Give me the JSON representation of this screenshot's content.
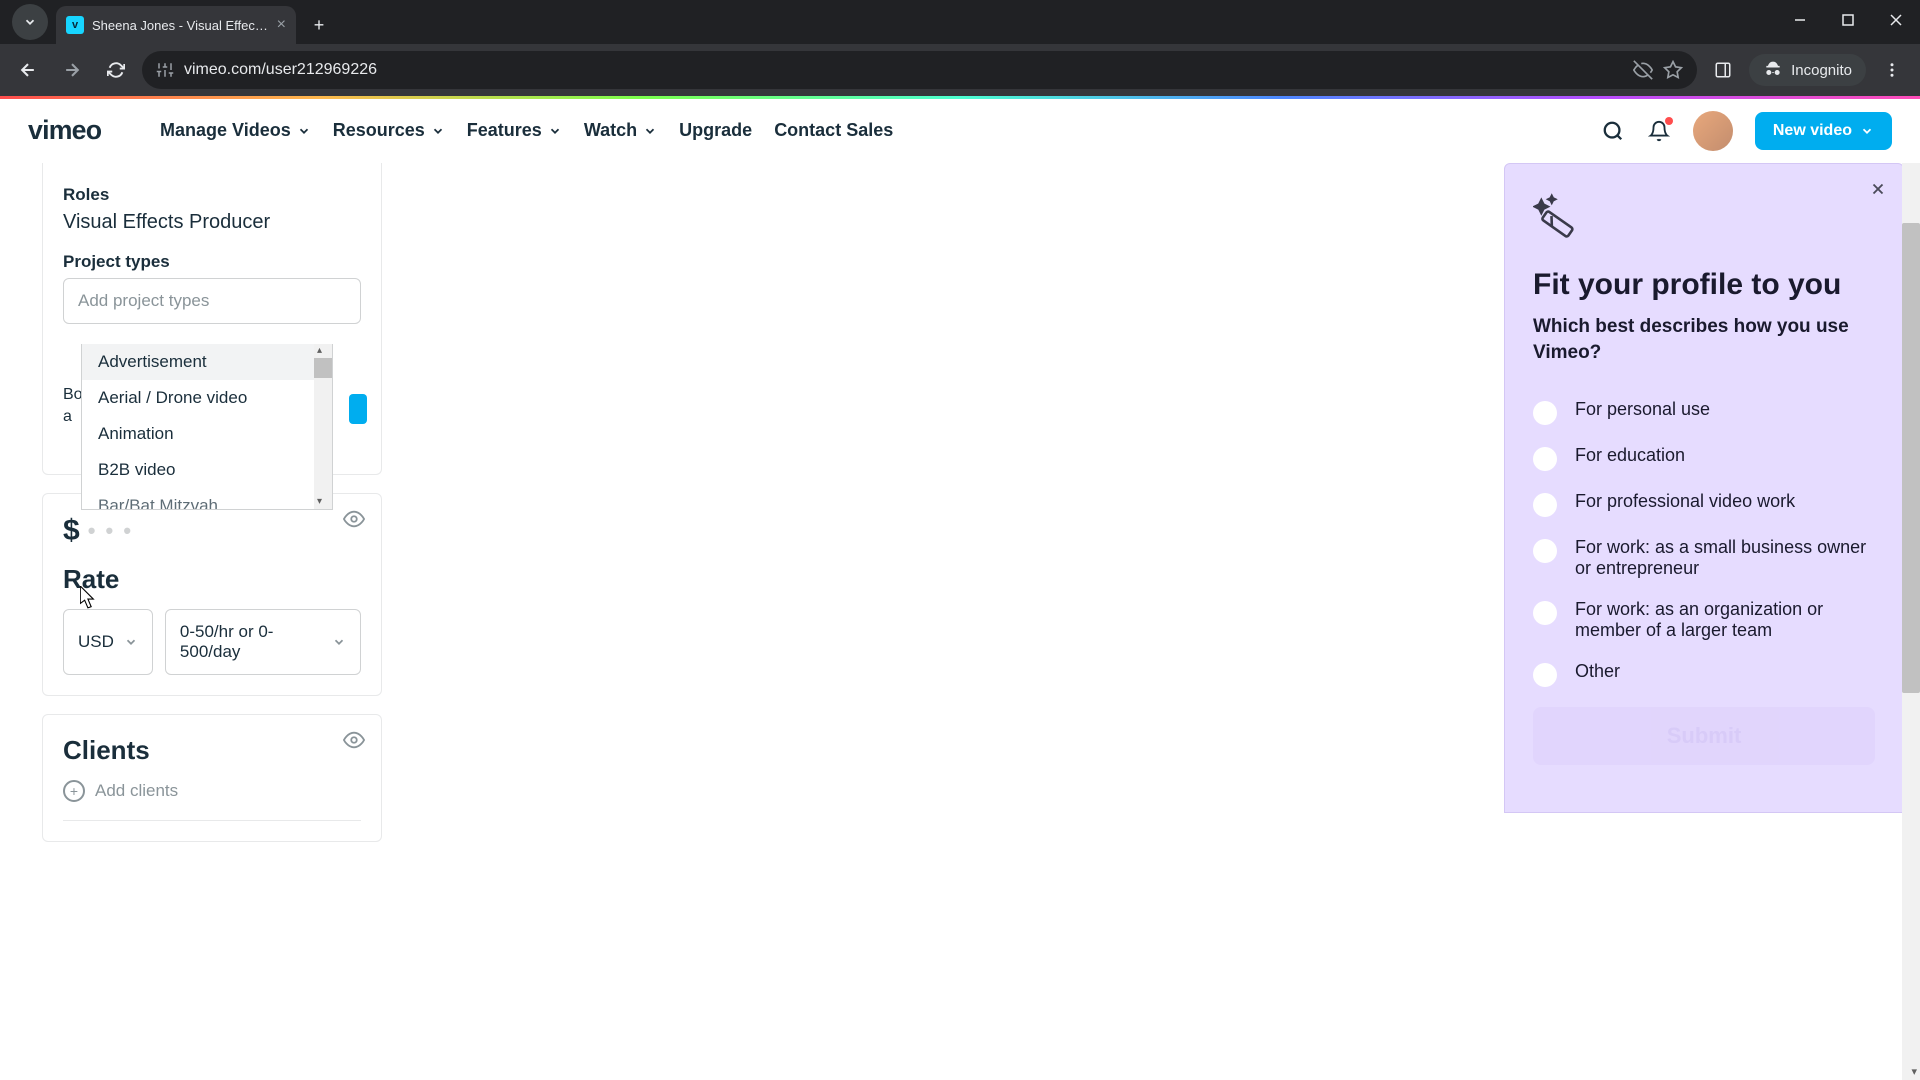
{
  "browser": {
    "tab_title": "Sheena Jones - Visual Effects P",
    "url": "vimeo.com/user212969226",
    "incognito_label": "Incognito"
  },
  "header": {
    "nav": {
      "manage": "Manage Videos",
      "resources": "Resources",
      "features": "Features",
      "watch": "Watch",
      "upgrade": "Upgrade",
      "contact": "Contact Sales"
    },
    "new_video": "New video"
  },
  "profile": {
    "roles_label": "Roles",
    "roles_value": "Visual Effects Producer",
    "project_types_label": "Project types",
    "project_types_placeholder": "Add project types",
    "dropdown_options": [
      "Advertisement",
      "Aerial / Drone video",
      "Animation",
      "B2B video",
      "Bar/Bat Mitzvah"
    ],
    "behind_line1": "Bo",
    "behind_line2": "a",
    "rate_title": "Rate",
    "currency": "USD",
    "rate_range": "0-50/hr or 0-500/day",
    "clients_title": "Clients",
    "add_clients": "Add clients"
  },
  "survey": {
    "title": "Fit your profile to you",
    "subtitle": "Which best describes how you use Vimeo?",
    "options": [
      "For personal use",
      "For education",
      "For professional video work",
      "For work: as a small business owner or entrepreneur",
      "For work: as an organization or member of a larger team",
      "Other"
    ],
    "submit": "Submit"
  }
}
